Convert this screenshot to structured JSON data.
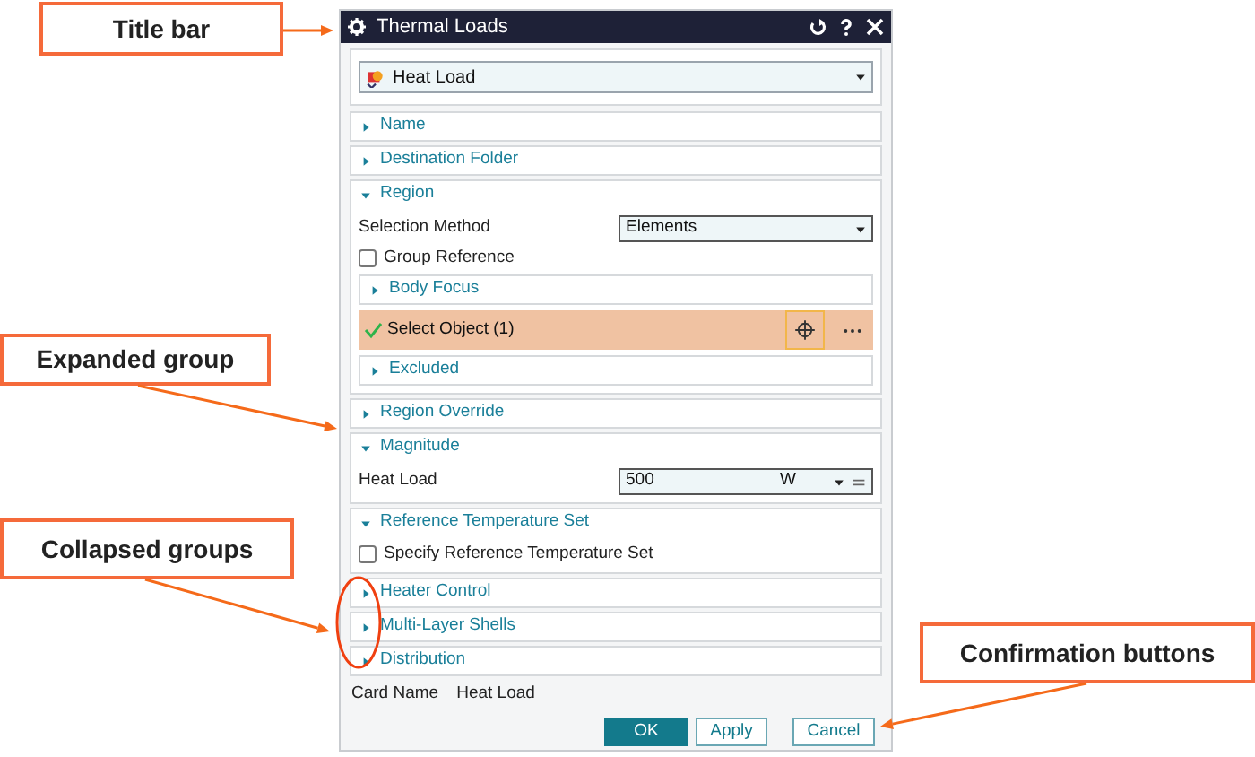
{
  "window": {
    "title": "Thermal Loads"
  },
  "type_selector": {
    "value": "Heat Load"
  },
  "groups": [
    {
      "title": "Name",
      "expanded": false
    },
    {
      "title": "Destination Folder",
      "expanded": false
    },
    {
      "title": "Region",
      "expanded": true,
      "fields": [
        {
          "kind": "dropdown",
          "label": "Selection Method",
          "value": "Elements"
        },
        {
          "kind": "checkbox",
          "label": "Group Reference",
          "checked": false
        },
        {
          "kind": "subgroup",
          "title": "Body Focus",
          "expanded": false
        },
        {
          "kind": "selection",
          "label": "Select Object (1)",
          "complete": true,
          "selected": true
        },
        {
          "kind": "subgroup",
          "title": "Excluded",
          "expanded": false
        }
      ]
    },
    {
      "title": "Region Override",
      "expanded": false
    },
    {
      "title": "Magnitude",
      "expanded": true,
      "fields": [
        {
          "kind": "unit_input",
          "label": "Heat Load",
          "value": "500",
          "unit": "W"
        }
      ]
    },
    {
      "title": "Reference Temperature Set",
      "expanded": true,
      "fields": [
        {
          "kind": "checkbox",
          "label": "Specify Reference Temperature Set",
          "checked": false
        }
      ]
    },
    {
      "title": "Heater Control",
      "expanded": false
    },
    {
      "title": "Multi-Layer Shells",
      "expanded": false
    },
    {
      "title": "Distribution",
      "expanded": false
    }
  ],
  "card_name": {
    "label": "Card Name",
    "value": "Heat Load"
  },
  "buttons": [
    {
      "label": "OK",
      "primary": true
    },
    {
      "label": "Apply",
      "primary": false
    },
    {
      "label": "Cancel",
      "primary": false
    }
  ],
  "callouts": [
    {
      "text": "Title bar"
    },
    {
      "text": "Expanded group"
    },
    {
      "text": "Collapsed groups"
    },
    {
      "text": "Confirmation buttons"
    }
  ]
}
